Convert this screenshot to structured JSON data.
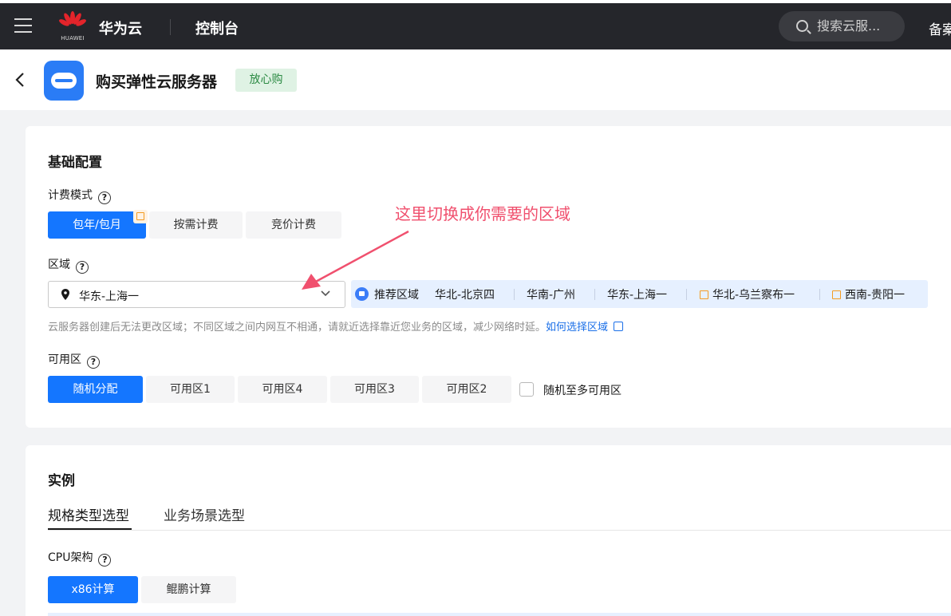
{
  "nav": {
    "brand": "华为云",
    "logo_text": "HUAWEI",
    "console": "控制台",
    "search_placeholder": "搜索云服...",
    "beian": "备案"
  },
  "header": {
    "title": "购买弹性云服务器",
    "badge": "放心购"
  },
  "basic": {
    "section_title": "基础配置",
    "billing": {
      "label": "计费模式",
      "options": [
        "包年/包月",
        "按需计费",
        "竞价计费"
      ],
      "selected": "包年/包月"
    },
    "region": {
      "label": "区域",
      "value": "华东-上海一",
      "recommended_label": "推荐区域",
      "recommended": [
        "华北-北京四",
        "华南-广州",
        "华东-上海一",
        "华北-乌兰察布一",
        "西南-贵阳一"
      ],
      "hint": "云服务器创建后无法更改区域；不同区域之间内网互不相通，请就近选择靠近您业务的区域，减少网络时延。",
      "hint_link": "如何选择区域"
    },
    "az": {
      "label": "可用区",
      "options": [
        "随机分配",
        "可用区1",
        "可用区4",
        "可用区3",
        "可用区2"
      ],
      "selected": "随机分配",
      "checkbox_label": "随机至多可用区"
    }
  },
  "instance": {
    "section_title": "实例",
    "tabs": [
      "规格类型选型",
      "业务场景选型"
    ],
    "cpu": {
      "label": "CPU架构",
      "options": [
        "x86计算",
        "鲲鹏计算"
      ],
      "selected": "x86计算"
    }
  },
  "annotation": {
    "text": "这里切换成你需要的区域"
  },
  "colors": {
    "primary": "#1476ff",
    "nav_bg": "#25262b",
    "annotation": "#f0506e",
    "badge_bg": "#dff2e4",
    "recommend_bg": "#e6f0ff"
  }
}
